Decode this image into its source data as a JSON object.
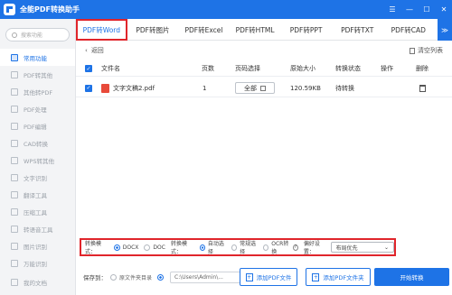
{
  "app": {
    "title": "全能PDF转换助手",
    "window_buttons": [
      "☰",
      "—",
      "☐",
      "✕"
    ]
  },
  "sidebar": {
    "search_placeholder": "搜索功能",
    "items": [
      {
        "label": "常用功能"
      },
      {
        "label": "PDF转其他"
      },
      {
        "label": "其他转PDF"
      },
      {
        "label": "PDF处理"
      },
      {
        "label": "PDF编辑"
      },
      {
        "label": "CAD转换"
      },
      {
        "label": "WPS转其他"
      },
      {
        "label": "文字识别"
      },
      {
        "label": "翻译工具"
      },
      {
        "label": "压缩工具"
      },
      {
        "label": "转语音工具"
      },
      {
        "label": "图片识别"
      },
      {
        "label": "万能识别"
      }
    ],
    "bottom_item": "我的文档"
  },
  "tabs": [
    "PDF转Word",
    "PDF转图片",
    "PDF转Excel",
    "PDF转HTML",
    "PDF转PPT",
    "PDF转TXT",
    "PDF转CAD",
    "≫"
  ],
  "toolbar": {
    "back": "返回",
    "back_arrow": "‹",
    "clear": "清空列表"
  },
  "table": {
    "headers": [
      "文件名",
      "页数",
      "页码选择",
      "原始大小",
      "转换状态",
      "操作",
      "删除"
    ],
    "rows": [
      {
        "name": "文字文稿2.pdf",
        "pages": "1",
        "page_sel": "全部",
        "size": "120.59KB",
        "status": "待转换"
      }
    ]
  },
  "options": {
    "format_label": "转换模式：",
    "docx": "DOCX",
    "doc": "DOC",
    "mode_label": "转换模式：",
    "auto": "自动选择",
    "normal": "常规选择",
    "ocr": "OCR转换",
    "help": "?",
    "pref_label": "偏好设置：",
    "pref_value": "布局优先"
  },
  "footer": {
    "save_label": "保存到：",
    "source_dir": "原文件夹目录",
    "path": "C:\\Users\\Admin\\...",
    "dots": "…",
    "add_file": "添加PDF文件",
    "add_folder": "添加PDF文件夹",
    "start": "开始转换"
  },
  "colors": {
    "accent": "#1e73e6",
    "highlight": "#e0252b"
  }
}
